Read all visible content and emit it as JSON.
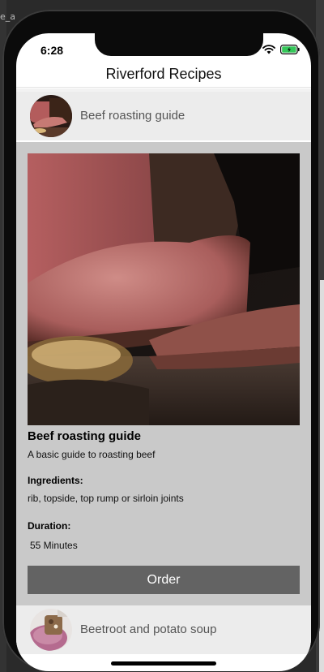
{
  "status_bar": {
    "time": "6:28"
  },
  "nav": {
    "title": "Riverford Recipes"
  },
  "recipes": [
    {
      "title": "Beef roasting guide",
      "thumbnail_icon": "roast-beef-photo"
    },
    {
      "title": "Beetroot and potato soup",
      "thumbnail_icon": "soup-bowl-photo"
    }
  ],
  "detail": {
    "title": "Beef roasting guide",
    "description": "A basic guide to roasting beef",
    "ingredients_label": "Ingredients:",
    "ingredients": "rib, topside, top rump or sirloin joints",
    "duration_label": "Duration:",
    "duration": "55 Minutes",
    "order_label": "Order",
    "hero_image": "sliced-roast-beef-photo"
  },
  "colors": {
    "row_background": "#ececec",
    "detail_background": "#c9c9c9",
    "order_button": "#636363",
    "battery": "#34c759"
  },
  "desktop_bg_text": "e_a"
}
